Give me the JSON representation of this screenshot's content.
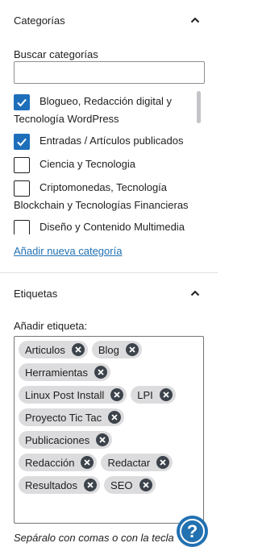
{
  "categories_panel": {
    "title": "Categorías",
    "search_label": "Buscar categorías",
    "search_value": "",
    "search_placeholder": "",
    "items": [
      {
        "label": "Blogueo, Redacción digital y Tecnología WordPress",
        "checked": true
      },
      {
        "label": "Entradas / Artículos publicados",
        "checked": true
      },
      {
        "label": "Ciencia y Tecnologia",
        "checked": false
      },
      {
        "label": "Criptomonedas, Tecnología Blockchain y Tecnologías Financieras",
        "checked": false
      },
      {
        "label": "Diseño y Contenido Multimedia",
        "checked": false
      }
    ],
    "add_link": "Añadir nueva categoría"
  },
  "tags_panel": {
    "title": "Etiquetas",
    "add_label": "Añadir etiqueta:",
    "tags": [
      "Articulos",
      "Blog",
      "Herramientas",
      "Linux Post Install",
      "LPI",
      "Proyecto Tic Tac",
      "Publicaciones",
      "Redacción",
      "Redactar",
      "Resultados",
      "SEO"
    ],
    "hint": "Sepáralo con comas o con la tecla"
  },
  "help_button": {
    "label": "?",
    "icon": "help-icon"
  },
  "colors": {
    "accent": "#2271b1",
    "checkbox_checked": "#1e6fba",
    "token_bg": "#dcdcde"
  }
}
